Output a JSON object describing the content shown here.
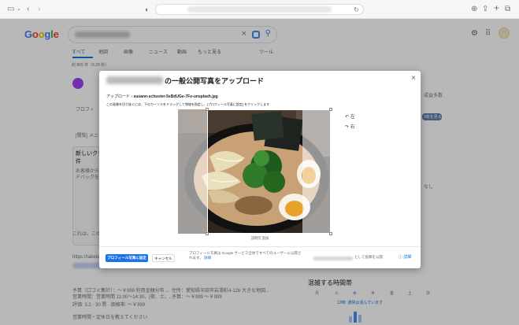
{
  "google": {
    "tabs": [
      "すべて",
      "地図",
      "画像",
      "ニュース",
      "動画",
      "もっと見る",
      "ツール"
    ],
    "results_count": "約 865 件（0.28 秒）",
    "left_panel": {
      "profile_label": "プロフィ",
      "menu_label": "[閲覧] メニ",
      "new_card_title": "新しいクチ",
      "new_card_line2": "件",
      "new_card_desc1": "お客様から",
      "new_card_desc2": "ドバックを",
      "footer_note": "これは、このア",
      "result_url": "https://tabelo",
      "result_line1": "予算（口コミ集計）：～￥999 利用金額分布 ...",
      "result_line1b": "住所：愛知県半田市岩滑町4-126 大きな地図...",
      "result_line2": "営業時間：営業時間 11:00～14:30、[夜、土、...",
      "result_line2b": "予算：～￥999 ～￥999",
      "result_rating": "評価: 3.2 · 30 票 · 価格帯: ～￥999",
      "hours_note": "営業時間・定休日を教えてください"
    },
    "right_panel": {
      "side_text": "成益多数",
      "side_button": "3枚を見る",
      "side_text2": "なし",
      "popular_times_title": "混雑する時間帯",
      "day_labels": [
        "月",
        "火",
        "水",
        "木",
        "金",
        "土",
        "日"
      ],
      "popular_now": "13時: 通常は混んでいます"
    }
  },
  "modal": {
    "title": "の一般公開写真をアップロード",
    "breadcrumb_prefix": "アップロード",
    "breadcrumb_separator": "›",
    "file_name": "susann-schuster-5xBdUGe-7Fo-unsplash.jpg",
    "instructions": "この画像を切り抜くには、下のカーソルをドラッグして領域を指定し、[プロフィール写真に設定] をクリックします",
    "caption_placeholder": "説明を追加",
    "rotate_left_label": "左",
    "rotate_right_label": "右",
    "primary_button": "プロフィール写真に設定",
    "cancel_button": "キャンセル",
    "notice_text": "プロフィール写真は Google サービス全体ですべてのユーザーに公開されます。",
    "notice_link": "詳細",
    "publish_suffix": "として投稿を公開",
    "help_label": "詳細",
    "close_label": "×"
  }
}
